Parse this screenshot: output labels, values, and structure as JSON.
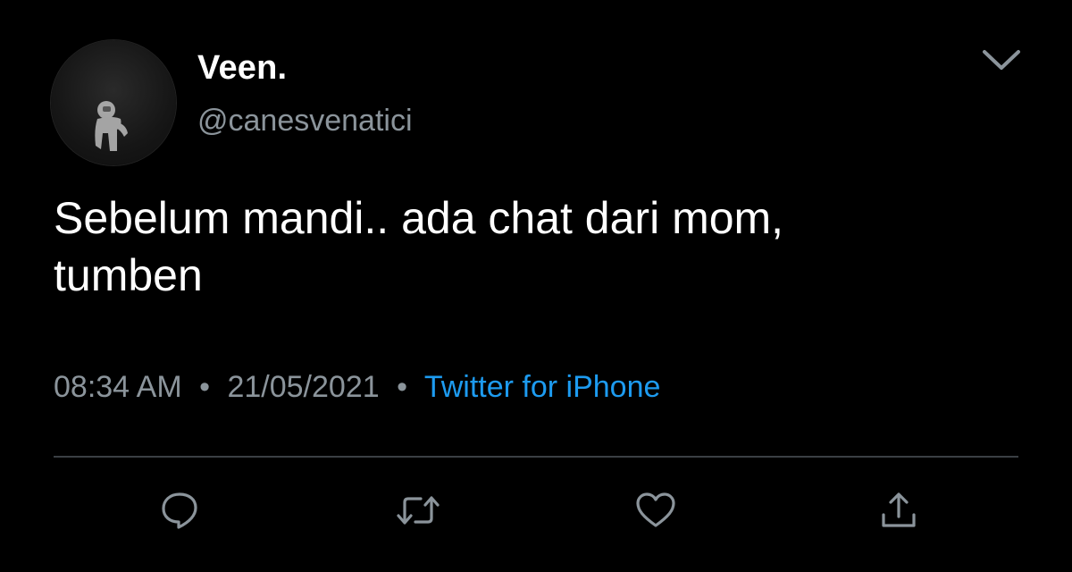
{
  "tweet": {
    "display_name": "Veen.",
    "handle": "@canesvenatici",
    "text_line1": "Sebelum mandi.. ada chat dari mom,",
    "text_line2": "tumben",
    "time": "08:34 AM",
    "date": "21/05/2021",
    "separator": "•",
    "source": "Twitter for iPhone"
  },
  "icons": {
    "avatar": "astronaut-avatar",
    "menu": "chevron-down-icon",
    "reply": "reply-icon",
    "retweet": "retweet-icon",
    "like": "heart-icon",
    "share": "share-icon"
  },
  "colors": {
    "background": "#000000",
    "text": "#ffffff",
    "secondary": "#8b949b",
    "link": "#1d9bf0"
  }
}
